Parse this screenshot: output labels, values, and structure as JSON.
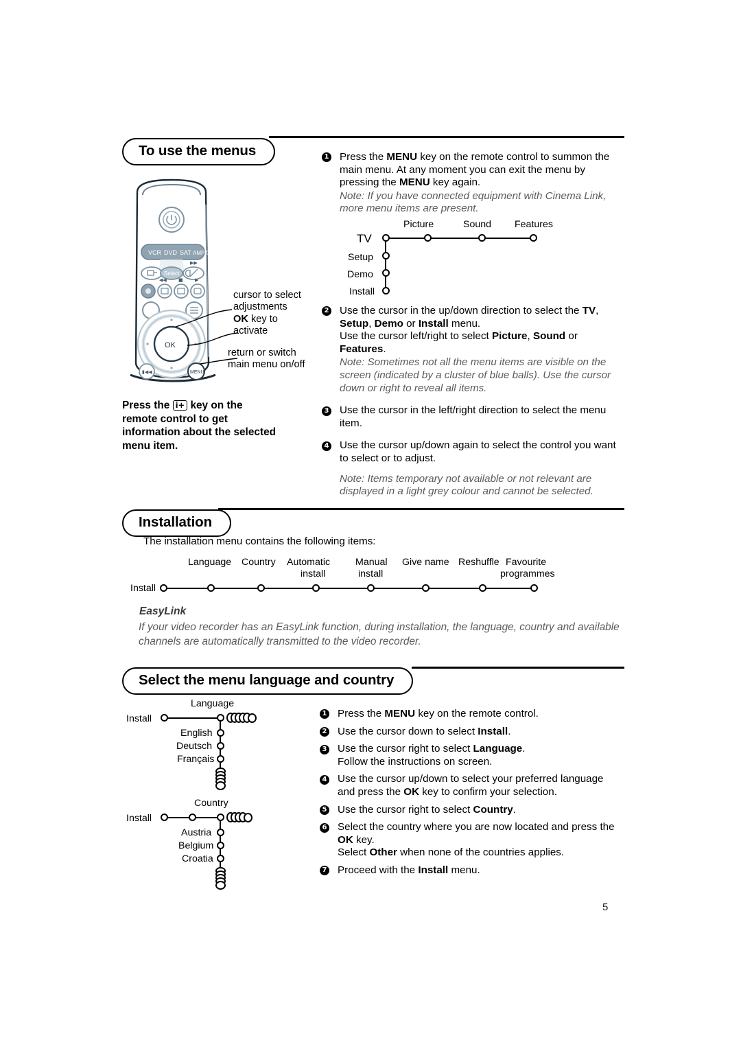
{
  "page": {
    "number": "5"
  },
  "section_menus": {
    "title": "To use the menus",
    "steps": [
      {
        "num": "1",
        "text": "Press the MENU key on the remote control to summon the main menu. At any moment you can exit the menu by pressing the MENU key again.",
        "note": "Note: If you have connected equipment with Cinema Link, more menu items are present."
      },
      {
        "num": "2",
        "text": "Use the cursor in the up/down direction to select the TV, Setup, Demo or Install menu. Use the cursor left/right to select Picture, Sound or Features.",
        "note": "Note: Sometimes not all the menu items are visible on the screen (indicated by a cluster of blue balls). Use the cursor down or right to reveal all items."
      },
      {
        "num": "3",
        "text": "Use the cursor in the left/right direction to select the menu item.",
        "note": ""
      },
      {
        "num": "4",
        "text": "Use the cursor up/down again to select the control you want to select or to adjust.",
        "note": "Note: Items temporary not available or not relevant are displayed in a light grey colour and cannot be selected."
      }
    ],
    "tree": {
      "root": "TV",
      "vertical_items": [
        "TV",
        "Setup",
        "Demo",
        "Install"
      ],
      "horizontal_items": [
        "Picture",
        "Sound",
        "Features"
      ]
    },
    "remote": {
      "power_label": "power-button",
      "mode_buttons": [
        "VCR",
        "DVD",
        "SAT",
        "AMP/CD"
      ],
      "select_label": "Select",
      "ok_label": "OK",
      "menu_label": "MENU",
      "callouts": [
        {
          "line1": "cursor to select",
          "line2": "adjustments"
        },
        {
          "line1": "OK key to",
          "line2": "activate",
          "bold_prefix": "OK"
        },
        {
          "line1": "return or switch",
          "line2": "main menu on/off"
        }
      ]
    },
    "left_note": {
      "before": "Press the",
      "key": "i+",
      "after": "key on the remote control to get information about the selected menu item."
    }
  },
  "section_installation": {
    "title": "Installation",
    "intro": "The installation menu contains the following items:",
    "tree": {
      "root": "Install",
      "items": [
        {
          "l1": "Language",
          "l2": ""
        },
        {
          "l1": "Country",
          "l2": ""
        },
        {
          "l1": "Automatic",
          "l2": "install"
        },
        {
          "l1": "Manual",
          "l2": "install"
        },
        {
          "l1": "Give name",
          "l2": ""
        },
        {
          "l1": "Reshuffle",
          "l2": ""
        },
        {
          "l1": "Favourite",
          "l2": "programmes"
        }
      ]
    },
    "easylink": {
      "heading": "EasyLink",
      "body": "If your video recorder has an EasyLink function, during installation, the language, country and available channels are automatically transmitted to the video recorder."
    }
  },
  "section_language": {
    "title": "Select the menu language and country",
    "language_tree": {
      "root": "Install",
      "branch": "Language",
      "children": [
        "English",
        "Deutsch",
        "Français"
      ]
    },
    "country_tree": {
      "root": "Install",
      "branch": "Country",
      "children": [
        "Austria",
        "Belgium",
        "Croatia"
      ]
    },
    "steps": [
      {
        "num": "1",
        "text": "Press the MENU key on the remote control."
      },
      {
        "num": "2",
        "text": "Use the cursor down to select Install."
      },
      {
        "num": "3",
        "text": "Use the cursor right to select Language. Follow the instructions on screen."
      },
      {
        "num": "4",
        "text": "Use the cursor up/down to select your preferred language and press the OK key to confirm your selection."
      },
      {
        "num": "5",
        "text": "Use the cursor right to select Country."
      },
      {
        "num": "6",
        "text": "Select the country where you are now located and press the OK key. Select Other when none of the countries applies."
      },
      {
        "num": "7",
        "text": "Proceed with the Install menu."
      }
    ]
  }
}
